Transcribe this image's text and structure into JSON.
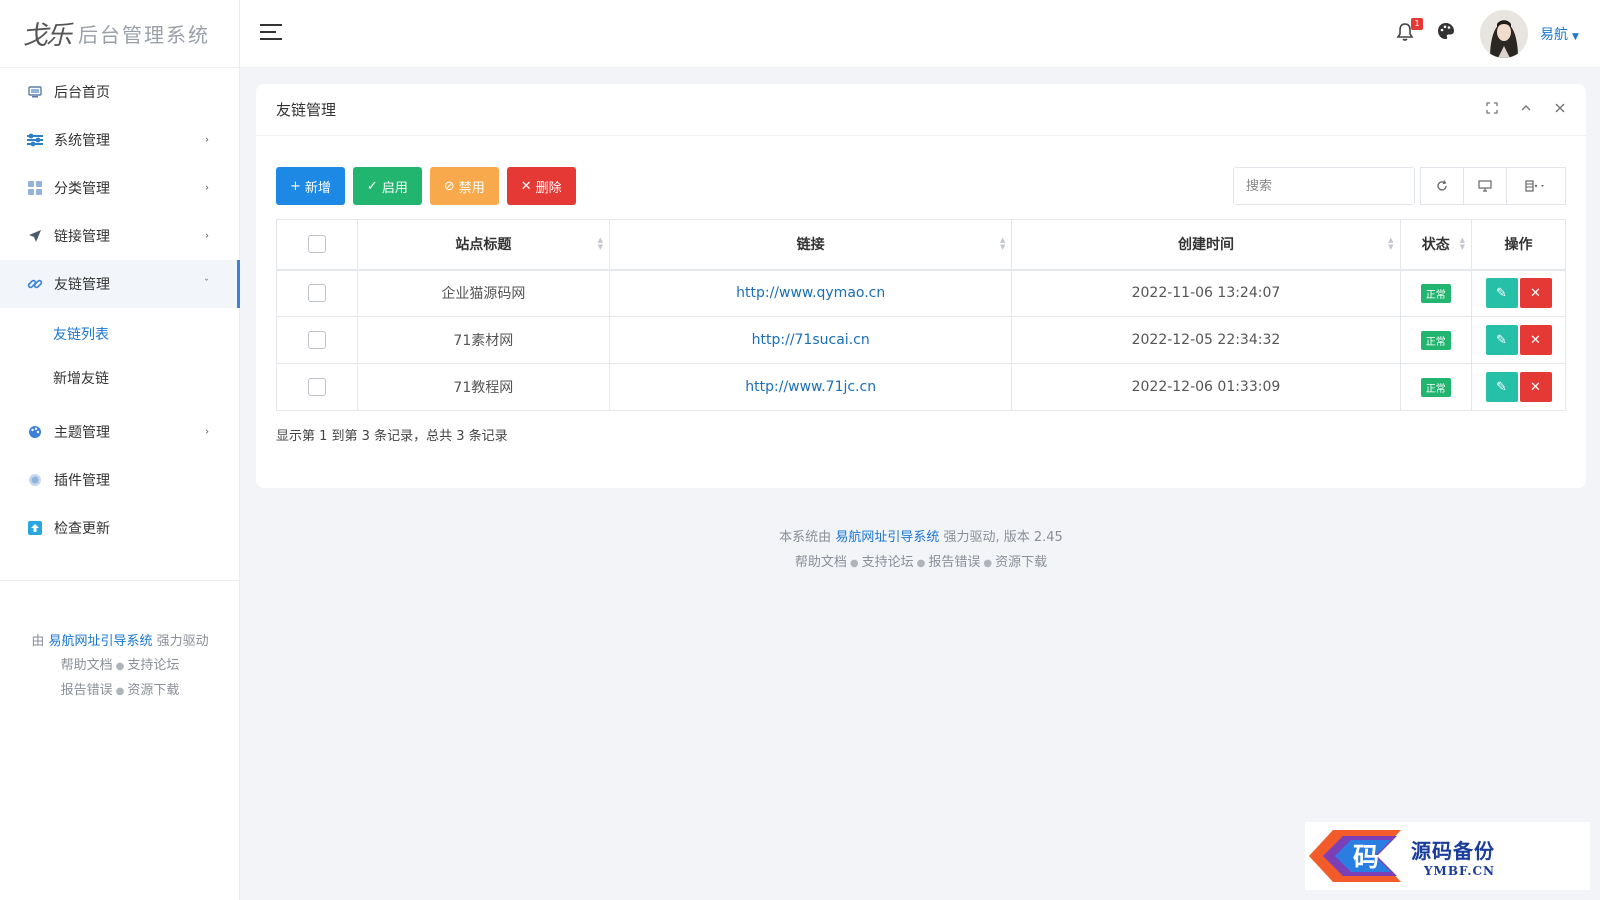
{
  "app": {
    "logo_mark": "戈乐",
    "title": "后台管理系统"
  },
  "sidebar": {
    "items": [
      {
        "label": "后台首页"
      },
      {
        "label": "系统管理",
        "chevron": "›"
      },
      {
        "label": "分类管理",
        "chevron": "›"
      },
      {
        "label": "链接管理",
        "chevron": "›"
      },
      {
        "label": "友链管理",
        "chevron": "ˇ"
      },
      {
        "label": "主题管理",
        "chevron": "›"
      },
      {
        "label": "插件管理"
      },
      {
        "label": "检查更新"
      }
    ],
    "submenu": [
      {
        "label": "友链列表"
      },
      {
        "label": "新增友链"
      }
    ],
    "footer": {
      "prefix": "由",
      "brand": "易航网址引导系统",
      "suffix": "强力驱动",
      "links": [
        "帮助文档",
        "支持论坛",
        "报告错误",
        "资源下载"
      ]
    }
  },
  "topbar": {
    "notification_count": "1",
    "username": "易航"
  },
  "card": {
    "title": "友链管理",
    "buttons": {
      "add": "新增",
      "enable": "启用",
      "disable": "禁用",
      "delete": "删除"
    },
    "search_placeholder": "搜索",
    "table": {
      "headers": [
        "站点标题",
        "链接",
        "创建时间",
        "状态",
        "操作"
      ],
      "rows": [
        {
          "title": "企业猫源码网",
          "link": "http://www.qymao.cn",
          "created": "2022-11-06 13:24:07",
          "status": "正常"
        },
        {
          "title": "71素材网",
          "link": "http://71sucai.cn",
          "created": "2022-12-05 22:34:32",
          "status": "正常"
        },
        {
          "title": "71教程网",
          "link": "http://www.71jc.cn",
          "created": "2022-12-06 01:33:09",
          "status": "正常"
        }
      ]
    },
    "pager_info": "显示第 1 到第 3 条记录，总共 3 条记录"
  },
  "footer": {
    "prefix": "本系统由",
    "brand": "易航网址引导系统",
    "suffix": "强力驱动, 版本 2.45",
    "links": [
      "帮助文档",
      "支持论坛",
      "报告错误",
      "资源下载"
    ]
  },
  "watermark": {
    "logo_char": "码",
    "cn": "源码备份",
    "en": "YMBF.CN"
  },
  "colors": {
    "primary": "#1e88e5",
    "success": "#21b570",
    "warning": "#f7a94b",
    "danger": "#e53935",
    "teal": "#26c0a8"
  }
}
